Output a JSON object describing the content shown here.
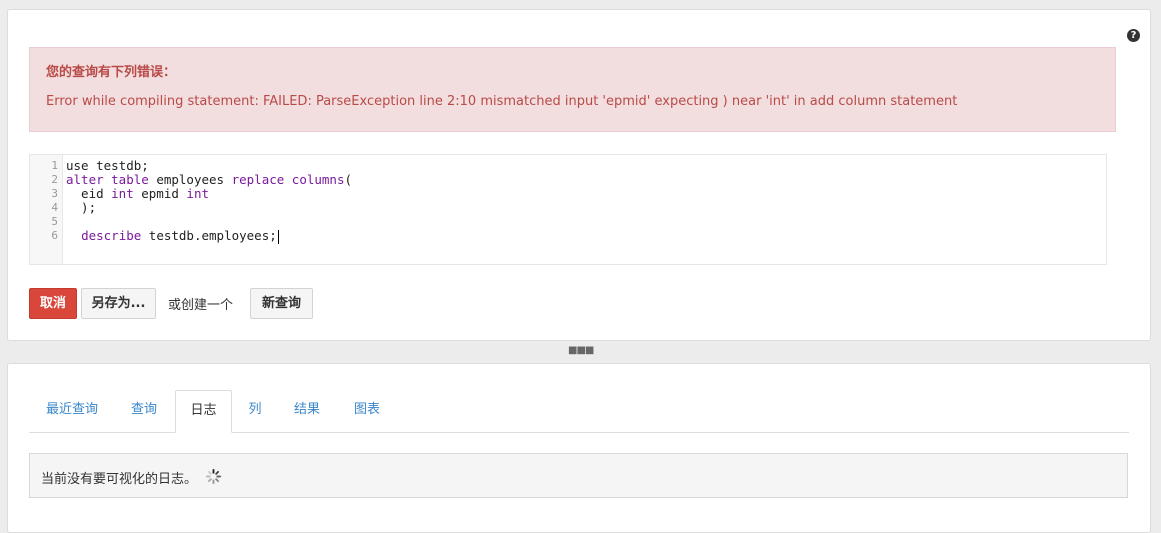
{
  "help_icon": "?",
  "error": {
    "title": "您的查询有下列错误：",
    "message": "Error while compiling statement: FAILED: ParseException line 2:10 mismatched input 'epmid' expecting ) near 'int' in add column statement"
  },
  "editor": {
    "line_numbers": [
      "1",
      "2",
      "3",
      "4",
      "5",
      "6"
    ],
    "lines": [
      {
        "parts": [
          {
            "t": "use testdb;",
            "kw": false
          }
        ]
      },
      {
        "parts": [
          {
            "t": "alter table",
            "kw": true
          },
          {
            "t": " employees ",
            "kw": false
          },
          {
            "t": "replace columns",
            "kw": true
          },
          {
            "t": "(",
            "kw": false
          }
        ]
      },
      {
        "parts": [
          {
            "t": "  eid ",
            "kw": false
          },
          {
            "t": "int",
            "kw": true
          },
          {
            "t": " epmid ",
            "kw": false
          },
          {
            "t": "int",
            "kw": true
          }
        ]
      },
      {
        "parts": [
          {
            "t": "  );",
            "kw": false
          }
        ]
      },
      {
        "parts": []
      },
      {
        "parts": [
          {
            "t": "  ",
            "kw": false
          },
          {
            "t": "describe",
            "kw": true
          },
          {
            "t": " testdb.employees;",
            "kw": false
          }
        ]
      }
    ]
  },
  "actions": {
    "cancel": "取消",
    "save_as": "另存为...",
    "or_create": "或创建一个",
    "new_query": "新查询"
  },
  "tabs": [
    {
      "label": "最近查询",
      "active": false
    },
    {
      "label": "查询",
      "active": false
    },
    {
      "label": "日志",
      "active": true
    },
    {
      "label": "列",
      "active": false
    },
    {
      "label": "结果",
      "active": false
    },
    {
      "label": "图表",
      "active": false
    }
  ],
  "log": {
    "message": "当前没有要可视化的日志。"
  },
  "colors": {
    "error_bg": "#f2dede",
    "error_text": "#b94a48",
    "danger_button": "#d9473b",
    "link": "#3a87c9",
    "keyword": "#7a1a9c"
  }
}
